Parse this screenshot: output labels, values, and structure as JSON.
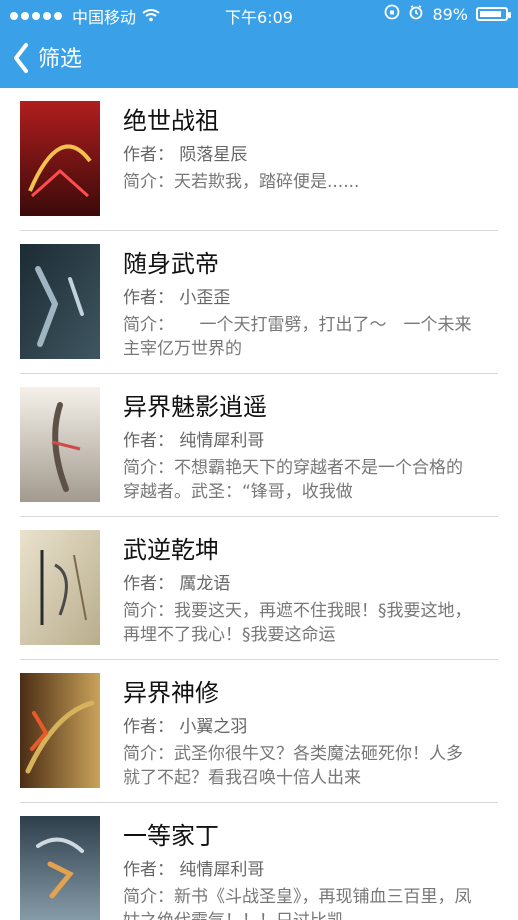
{
  "status_bar": {
    "carrier": "中国移动",
    "time": "下午6:09",
    "battery": "89%",
    "battery_level": 0.89
  },
  "nav": {
    "back_label": "筛选"
  },
  "books": [
    {
      "title": "绝世战祖",
      "author_label": "作者：",
      "author": "陨落星辰",
      "desc_label": "简介：",
      "desc": "天若欺我，踏碎便是......",
      "colors": [
        "#b01e1e",
        "#3b0a0a"
      ]
    },
    {
      "title": "随身武帝",
      "author_label": "作者：",
      "author": "小歪歪",
      "desc_label": "简介：",
      "desc": "　　一个天打雷劈，打出了～　一个未来主宰亿万世界的",
      "colors": [
        "#1b2b33",
        "#3f5661"
      ]
    },
    {
      "title": "异界魅影逍遥",
      "author_label": "作者：",
      "author": "纯情犀利哥",
      "desc_label": "简介：",
      "desc": "不想霸艳天下的穿越者不是一个合格的穿越者。武圣：“锋哥，收我做",
      "colors": [
        "#f5f1ea",
        "#a29a8e"
      ]
    },
    {
      "title": "武逆乾坤",
      "author_label": "作者：",
      "author": "厲龙语",
      "desc_label": "简介：",
      "desc": "我要这天，再遮不住我眼！§我要这地，再埋不了我心！§我要这命运",
      "colors": [
        "#e9e2cd",
        "#b9ad8c"
      ]
    },
    {
      "title": "异界神修",
      "author_label": "作者：",
      "author": "小翼之羽",
      "desc_label": "简介：",
      "desc": "武圣你很牛叉？各类魔法砸死你！人多就了不起？看我召唤十倍人出来",
      "colors": [
        "#4b2d14",
        "#caa35a"
      ]
    },
    {
      "title": "一等家丁",
      "author_label": "作者：",
      "author": "纯情犀利哥",
      "desc_label": "简介：",
      "desc": "新书《斗战圣皇》，再现铺血三百里，凤姑之绝代霸气！！！只过比凯",
      "colors": [
        "#2e3f4c",
        "#8fa4b1"
      ]
    }
  ]
}
